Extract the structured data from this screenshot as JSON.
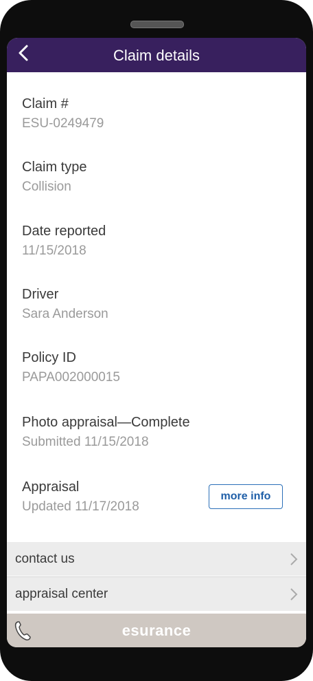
{
  "header": {
    "title": "Claim details",
    "back_icon": "chevron-left-icon"
  },
  "fields": [
    {
      "label": "Claim #",
      "value": "ESU-0249479"
    },
    {
      "label": "Claim type",
      "value": "Collision"
    },
    {
      "label": "Date reported",
      "value": "11/15/2018"
    },
    {
      "label": "Driver",
      "value": "Sara Anderson"
    },
    {
      "label": "Policy ID",
      "value": "PAPA002000015"
    },
    {
      "label": "Photo appraisal—Complete",
      "value": "Submitted 11/15/2018"
    },
    {
      "label": "Appraisal",
      "value": "Updated 11/17/2018"
    }
  ],
  "more_info_label": "more info",
  "links": [
    {
      "label": "contact us"
    },
    {
      "label": "appraisal center"
    }
  ],
  "footer": {
    "logo_text": "esurance",
    "phone_icon": "phone-icon"
  },
  "colors": {
    "header_bg": "#38205e",
    "footer_bg": "#cfc8c2",
    "link_blue": "#1f5fa8"
  }
}
